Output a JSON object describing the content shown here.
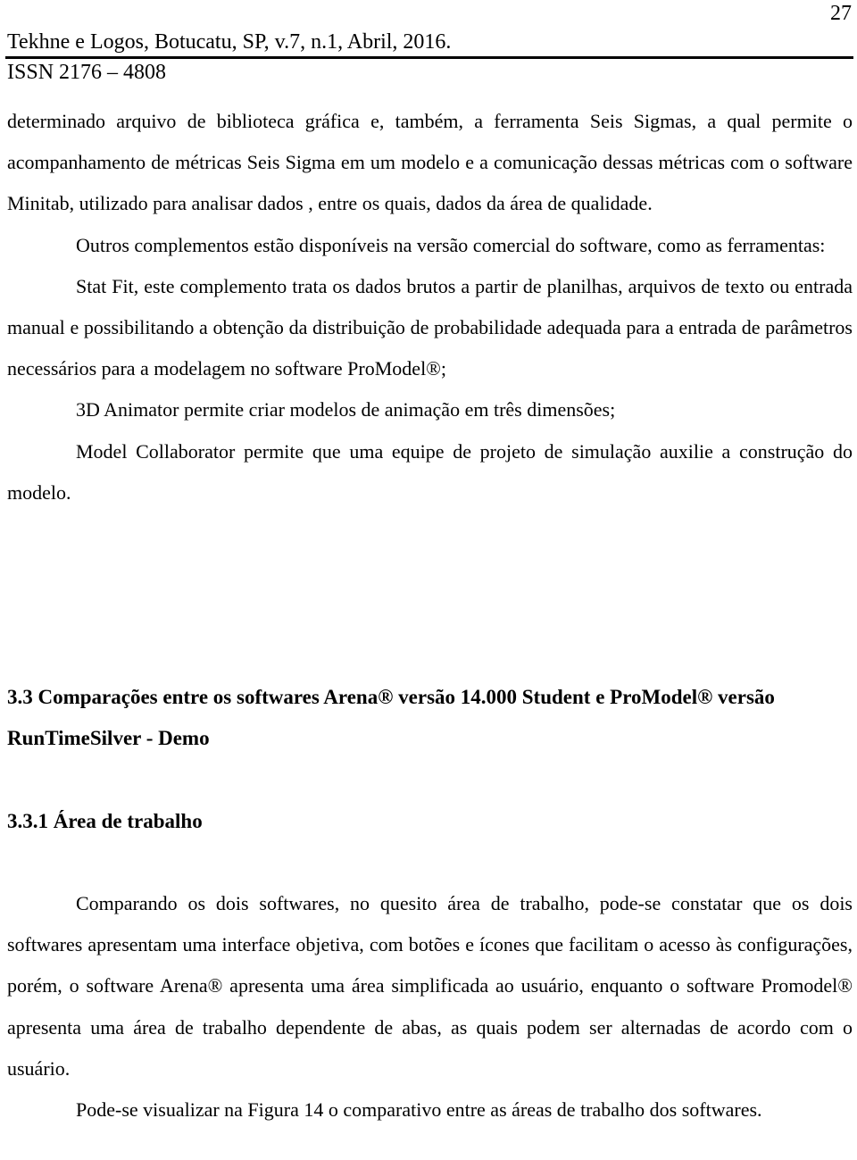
{
  "header": {
    "page_number": "27",
    "journal": "Tekhne e Logos, Botucatu, SP, v.7, n.1, Abril, 2016.",
    "issn": "ISSN 2176 – 4808"
  },
  "paragraphs": {
    "p1": "determinado arquivo de biblioteca gráfica e, também, a ferramenta Seis Sigmas, a qual permite o acompanhamento de métricas Seis Sigma em um modelo e a comunicação dessas métricas com o software Minitab, utilizado para analisar dados , entre os quais, dados da área de qualidade.",
    "p2": "Outros complementos estão disponíveis na versão comercial do software, como as ferramentas:",
    "p3": "Stat Fit, este complemento trata os dados brutos a partir de planilhas, arquivos de texto ou entrada manual e possibilitando a obtenção da distribuição de probabilidade adequada para a entrada de parâmetros necessários para a modelagem no software ProModel®;",
    "p4": "3D Animator permite criar modelos de animação em três dimensões;",
    "p5": "Model Collaborator permite que uma equipe de projeto de simulação auxilie a construção do modelo.",
    "p6": "Comparando os dois softwares, no quesito área de trabalho, pode-se constatar que os dois softwares apresentam uma interface objetiva, com botões e ícones que facilitam o acesso às configurações, porém, o software Arena® apresenta uma área simplificada ao usuário, enquanto o software Promodel® apresenta uma área de trabalho dependente de abas, as quais podem ser alternadas de acordo com o usuário.",
    "p7": "Pode-se visualizar na Figura 14 o comparativo entre as áreas de trabalho dos softwares."
  },
  "headings": {
    "section_3_3": "3.3 Comparações entre os softwares Arena® versão 14.000 Student e ProModel® versão RunTimeSilver - Demo",
    "section_3_3_1": "3.3.1 Área de trabalho"
  }
}
